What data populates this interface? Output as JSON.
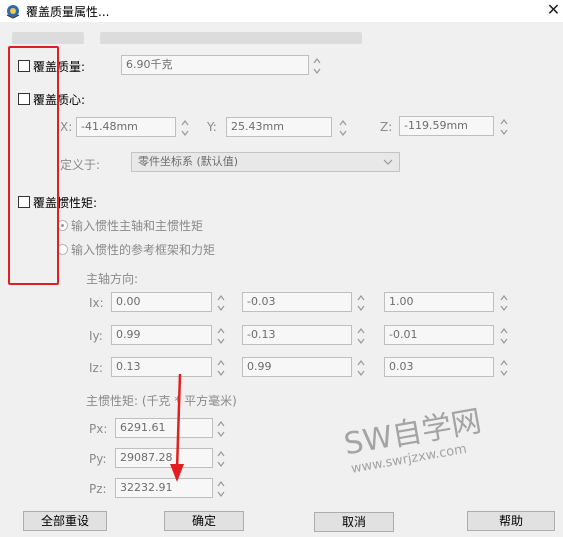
{
  "window": {
    "title": "覆盖质量属性...",
    "close": "✕"
  },
  "override_mass": {
    "label": "覆盖质量:",
    "value": "6.90千克"
  },
  "override_com": {
    "label": "覆盖质心:",
    "x_label": "X:",
    "x_value": "-41.48mm",
    "y_label": "Y:",
    "y_value": "25.43mm",
    "z_label": "Z:",
    "z_value": "-119.59mm",
    "defined_label": "定义于:",
    "defined_value": "零件坐标系 (默认值)"
  },
  "override_inertia": {
    "label": "覆盖惯性矩:",
    "radio1": "输入惯性主轴和主惯性矩",
    "radio2": "输入惯性的参考框架和力矩",
    "axis_heading": "主轴方向:",
    "rows": [
      {
        "label": "Ix:",
        "values": [
          "0.00",
          "-0.03",
          "1.00"
        ]
      },
      {
        "label": "Iy:",
        "values": [
          "0.99",
          "-0.13",
          "-0.01"
        ]
      },
      {
        "label": "Iz:",
        "values": [
          "0.13",
          "0.99",
          "0.03"
        ]
      }
    ],
    "moments_heading": "主惯性矩: (千克 * 平方毫米)",
    "px_label": "Px:",
    "px_value": "6291.61",
    "py_label": "Py:",
    "py_value": "29087.28",
    "pz_label": "Pz:",
    "pz_value": "32232.91"
  },
  "buttons": {
    "reset_all": "全部重设",
    "ok": "确定",
    "cancel": "取消",
    "help": "帮助"
  },
  "watermark": {
    "main": "SW自学网",
    "url": "www.swrjzxw.com"
  },
  "colors": {
    "annotation_red": "#e02020",
    "watermark": "#a4a4a4"
  }
}
